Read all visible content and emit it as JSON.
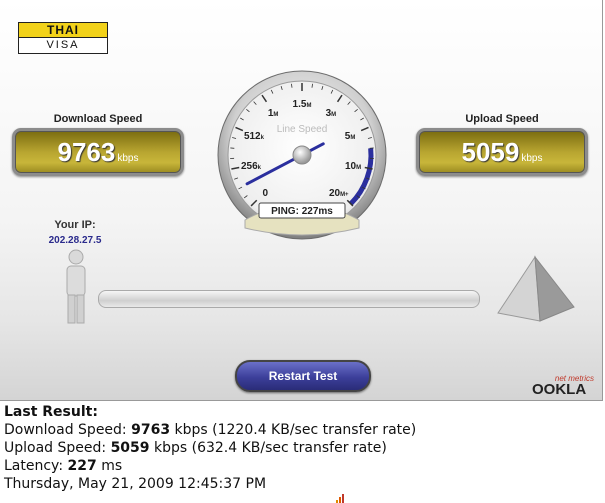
{
  "logo": {
    "line1": "THAI",
    "line2": "VISA"
  },
  "download": {
    "title": "Download Speed",
    "value": "9763",
    "unit": "kbps"
  },
  "upload": {
    "title": "Upload Speed",
    "value": "5059",
    "unit": "kbps"
  },
  "ip": {
    "label": "Your IP:",
    "value": "202.28.27.5"
  },
  "gauge": {
    "title": "Line Speed",
    "ticks": [
      {
        "num": "0",
        "suf": ""
      },
      {
        "num": "256",
        "suf": "k"
      },
      {
        "num": "512",
        "suf": "k"
      },
      {
        "num": "1",
        "suf": "M"
      },
      {
        "num": "1.5",
        "suf": "M"
      },
      {
        "num": "3",
        "suf": "M"
      },
      {
        "num": "5",
        "suf": "M"
      },
      {
        "num": "10",
        "suf": "M"
      },
      {
        "num": "20",
        "suf": "M+"
      }
    ],
    "ping_label": "PING:",
    "ping_value": "227",
    "ping_unit": "ms"
  },
  "restart_label": "Restart Test",
  "brand": {
    "small": "net metrics",
    "name": "OOKLA"
  },
  "results": {
    "heading": "Last Result:",
    "download_prefix": "Download Speed:",
    "download_value": "9763",
    "download_suffix": "kbps (1220.4 KB/sec transfer rate)",
    "upload_prefix": "Upload Speed:",
    "upload_value": "5059",
    "upload_suffix": "kbps (632.4 KB/sec transfer rate)",
    "latency_prefix": "Latency:",
    "latency_value": "227",
    "latency_suffix": "ms",
    "timestamp": "Thursday, May 21, 2009 12:45:37 PM"
  },
  "colors": {
    "accent_blue": "#2b2f9e",
    "gold": "#b8a530",
    "ookla_red": "#c0392b"
  }
}
